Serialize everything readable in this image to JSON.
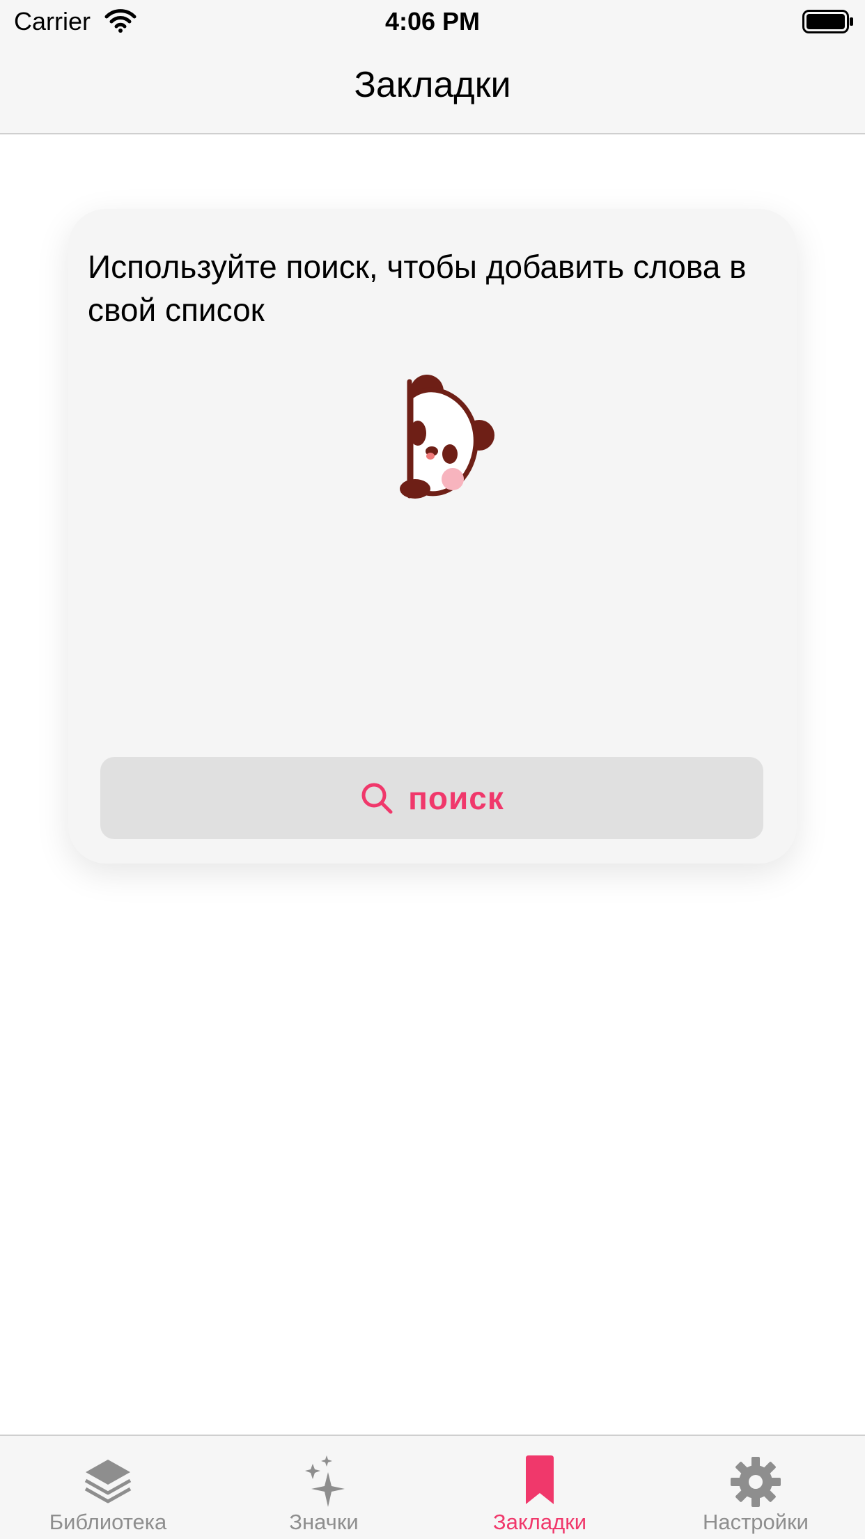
{
  "status_bar": {
    "carrier": "Carrier",
    "time": "4:06 PM",
    "icons": [
      "wifi-icon",
      "battery-icon"
    ]
  },
  "nav": {
    "title": "Закладки"
  },
  "card": {
    "message": "Используйте поиск, чтобы добавить слова в свой список",
    "illustration": "panda-peek-icon",
    "search_button": {
      "icon": "search-icon",
      "label": "поиск"
    }
  },
  "tab_bar": {
    "active_index": 2,
    "tabs": [
      {
        "label": "Библиотека",
        "icon": "layers-icon"
      },
      {
        "label": "Значки",
        "icon": "sparkles-icon"
      },
      {
        "label": "Закладки",
        "icon": "bookmark-icon"
      },
      {
        "label": "Настройки",
        "icon": "gear-icon"
      }
    ]
  },
  "colors": {
    "accent": "#f0386b",
    "inactive": "#8e8e8e",
    "bar_background": "#f6f6f6",
    "card_background": "#f5f5f5",
    "button_background": "#e0e0e0",
    "panda_brown": "#6e1f16"
  }
}
